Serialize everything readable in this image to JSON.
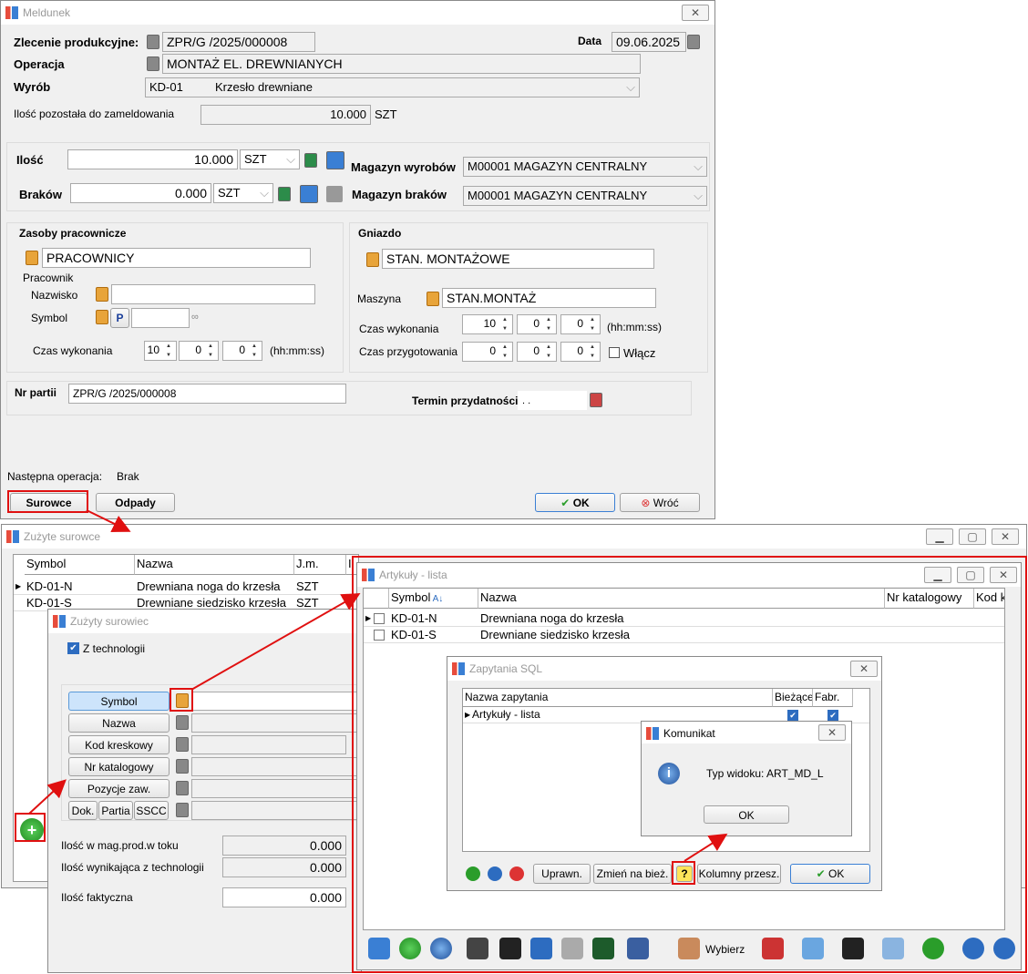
{
  "meldunek": {
    "title": "Meldunek",
    "close": "✕",
    "zlecenie_label": "Zlecenie produkcyjne:",
    "zlecenie": "ZPR/G /2025/000008",
    "data_label": "Data",
    "data": "09.06.2025",
    "operacja_label": "Operacja",
    "operacja": "MONTAŻ EL. DREWNIANYCH",
    "wyrob_label": "Wyrób",
    "wyrob_kod": "KD-01",
    "wyrob_nazwa": "Krzesło drewniane",
    "ilosc_poz_label": "Ilość pozostała do zameldowania",
    "ilosc_poz": "10.000",
    "ilosc_poz_jm": "SZT",
    "ilosc_label": "Ilość",
    "ilosc": "10.000",
    "ilosc_jm": "SZT",
    "brakow_label": "Braków",
    "brakow": "0.000",
    "brakow_jm": "SZT",
    "mag_wyr_label": "Magazyn wyrobów",
    "mag_wyr": "M00001 MAGAZYN CENTRALNY",
    "mag_brak_label": "Magazyn braków",
    "mag_brak": "M00001 MAGAZYN CENTRALNY",
    "zasoby_label": "Zasoby pracownicze",
    "pracownicy": "PRACOWNICY",
    "pracownik_label": "Pracownik",
    "nazwisko_label": "Nazwisko",
    "symbol_label": "Symbol",
    "p_btn": "P",
    "czas_wyk_label": "Czas wykonania",
    "czas1": [
      "10",
      "0",
      "0"
    ],
    "hms": "(hh:mm:ss)",
    "gniazdo_label": "Gniazdo",
    "gniazdo": "STAN. MONTAŻOWE",
    "maszyna_label": "Maszyna",
    "maszyna": "STAN.MONTAŻ",
    "czas_wyk2_label": "Czas wykonania",
    "czas2": [
      "10",
      "0",
      "0"
    ],
    "czas_przyg_label": "Czas przygotowania",
    "czas3": [
      "0",
      "0",
      "0"
    ],
    "wlacz": "Włącz",
    "nr_partii_label": "Nr partii",
    "nr_partii": "ZPR/G /2025/000008",
    "termin_label": "Termin przydatności",
    "termin": " .  .",
    "nastepna_label": "Następna operacja:",
    "nastepna": "Brak",
    "surowce_btn": "Surowce",
    "odpady_btn": "Odpady",
    "ok_btn": "OK",
    "wroc_btn": "Wróć"
  },
  "zuzyte": {
    "title": "Zużyte surowce",
    "cols": [
      "Symbol",
      "Nazwa",
      "J.m.",
      "Il"
    ],
    "rows": [
      [
        "KD-01-N",
        "Drewniana noga do krzesła",
        "SZT"
      ],
      [
        "KD-01-S",
        "Drewniane siedzisko krzesła",
        "SZT"
      ]
    ]
  },
  "surowiec": {
    "title": "Zużyty surowiec",
    "z_tech": "Z technologii",
    "buttons": [
      "Symbol",
      "Nazwa",
      "Kod kreskowy",
      "Nr katalogowy",
      "Pozycje zaw."
    ],
    "small": [
      "Dok.",
      "Partia",
      "SSCC"
    ],
    "ilosc_mag_label": "Ilość w mag.prod.w toku",
    "ilosc_mag": "0.000",
    "ilosc_tech_label": "Ilość wynikająca z technologii",
    "ilosc_tech": "0.000",
    "ilosc_fakt_label": "Ilość faktyczna",
    "ilosc_fakt": "0.000"
  },
  "artykuly": {
    "title": "Artykuły - lista",
    "cols": [
      "Symbol",
      "Nazwa",
      "Nr katalogowy",
      "Kod kresk"
    ],
    "rows": [
      [
        "KD-01-N",
        "Drewniana noga do krzesła"
      ],
      [
        "KD-01-S",
        "Drewniane siedzisko krzesła"
      ]
    ],
    "wybierz": "Wybierz"
  },
  "sql": {
    "title": "Zapytania SQL",
    "cols": [
      "Nazwa zapytania",
      "Bieżące",
      "Fabr."
    ],
    "row": "Artykuły - lista",
    "uprawn": "Uprawn.",
    "zmien": "Zmień na bież.",
    "kolumny": "Kolumny przesz.",
    "ok": "OK"
  },
  "komunikat": {
    "title": "Komunikat",
    "text": "Typ widoku: ART_MD_L",
    "ok": "OK"
  },
  "colors": {
    "accent": "#e01010",
    "ok_check": "#2a9d2a",
    "focus": "#3a7fd4"
  }
}
